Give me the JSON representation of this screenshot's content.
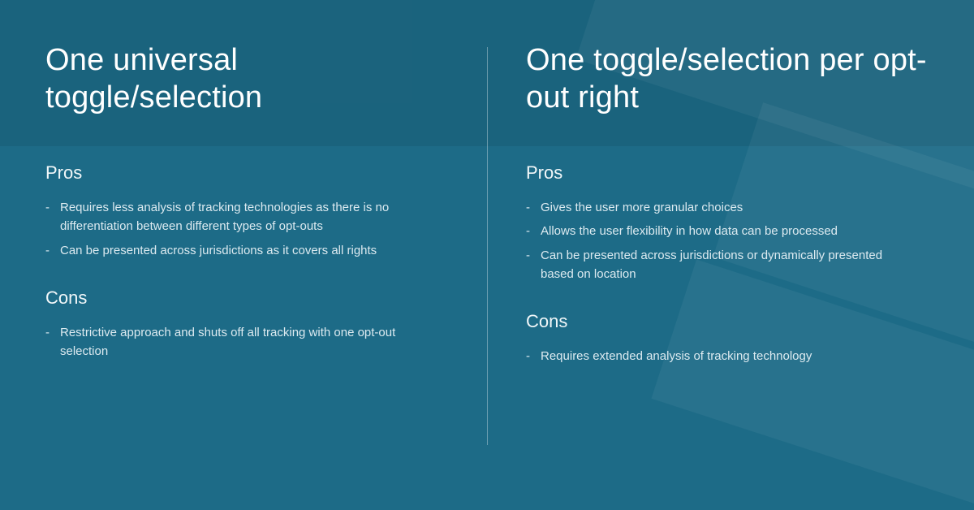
{
  "left": {
    "title": "One universal toggle/selection",
    "pros_label": "Pros",
    "pros": [
      "Requires less analysis of tracking technologies as there is no differentiation between different types of opt-outs",
      "Can be presented across jurisdictions as it covers all rights"
    ],
    "cons_label": "Cons",
    "cons": [
      "Restrictive approach and shuts off all tracking with one opt-out selection"
    ]
  },
  "right": {
    "title": "One toggle/selection per opt-out right",
    "pros_label": "Pros",
    "pros": [
      "Gives the user more granular choices",
      "Allows the user flexibility in how data can be processed",
      "Can be presented across jurisdictions or dynamically presented based on location"
    ],
    "cons_label": "Cons",
    "cons": [
      "Requires extended analysis of tracking technology"
    ]
  }
}
